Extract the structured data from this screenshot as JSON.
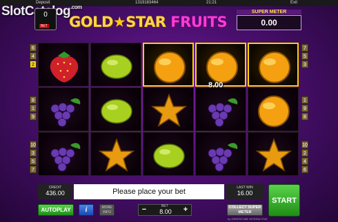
{
  "topbar": {
    "deposit": "Deposit",
    "account": "1319183464",
    "time": "21:21",
    "exit": "Exit"
  },
  "watermark": {
    "text": "SlotCatalog",
    "suffix": ".com"
  },
  "bet_badge": {
    "value": "0",
    "label": "BET"
  },
  "logo": {
    "part1": "GOLD",
    "part2": "STAR",
    "part3": "FRUITS"
  },
  "super_meter": {
    "label": "SUPER METER",
    "value": "0.00"
  },
  "left_indicators": [
    "6",
    "4",
    "2",
    "8",
    "1",
    "9",
    "10",
    "3",
    "5",
    "7"
  ],
  "right_indicators": [
    "7",
    "5",
    "3",
    "1",
    "9",
    "8",
    "10",
    "2",
    "4",
    "6"
  ],
  "reels": [
    [
      "strawberry",
      "grape",
      "grape"
    ],
    [
      "lemon",
      "lemon",
      "star"
    ],
    [
      "orange",
      "star",
      "lemon"
    ],
    [
      "orange",
      "grape",
      "grape"
    ],
    [
      "orange",
      "orange",
      "star"
    ]
  ],
  "win_amount": "8.00",
  "credit": {
    "label": "CREDIT",
    "value": "436.00"
  },
  "message": "Please place your bet",
  "last_win": {
    "label": "LAST WIN",
    "value": "16.00"
  },
  "buttons": {
    "start": "START",
    "autoplay": "AUTOPLAY",
    "info": "i",
    "more_info": "MORE INFO",
    "collect": "COLLECT SUPER METER"
  },
  "bet": {
    "label": "BET",
    "value": "8.00",
    "minus": "−",
    "plus": "+"
  },
  "maker": "by GREENTUBE INTERACTIVE",
  "colors": {
    "win_frame": "#ffd200",
    "start_green": "#1f8e17",
    "background": "#4a0f6e"
  }
}
